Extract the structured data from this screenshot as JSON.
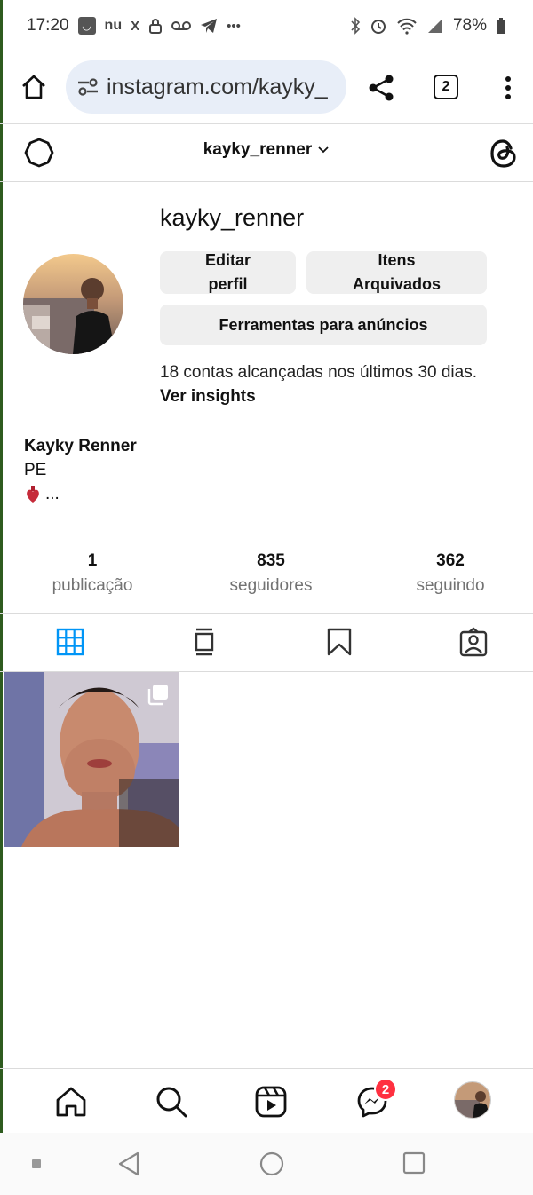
{
  "status_bar": {
    "time": "17:20",
    "battery": "78%"
  },
  "browser": {
    "url": "instagram.com/kayky_",
    "tab_count": "2"
  },
  "header": {
    "username": "kayky_renner"
  },
  "profile": {
    "name": "kayky_renner",
    "edit_button": "Editar perfil",
    "archived_button": "Itens Arquivados",
    "tools_button": "Ferramentas para anúncios",
    "insights_text": "18 contas alcançadas nos últimos 30 dias.",
    "insights_link": "Ver insights"
  },
  "bio": {
    "display_name": "Kayky Renner",
    "line1": "PE",
    "line2": "..."
  },
  "stats": [
    {
      "value": "1",
      "label": "publicação"
    },
    {
      "value": "835",
      "label": "seguidores"
    },
    {
      "value": "362",
      "label": "seguindo"
    }
  ],
  "bottom_nav": {
    "messages_badge": "2"
  },
  "colors": {
    "active_tab": "#0095f6",
    "badge": "#ff3040",
    "url_bg": "#e8eef8"
  }
}
